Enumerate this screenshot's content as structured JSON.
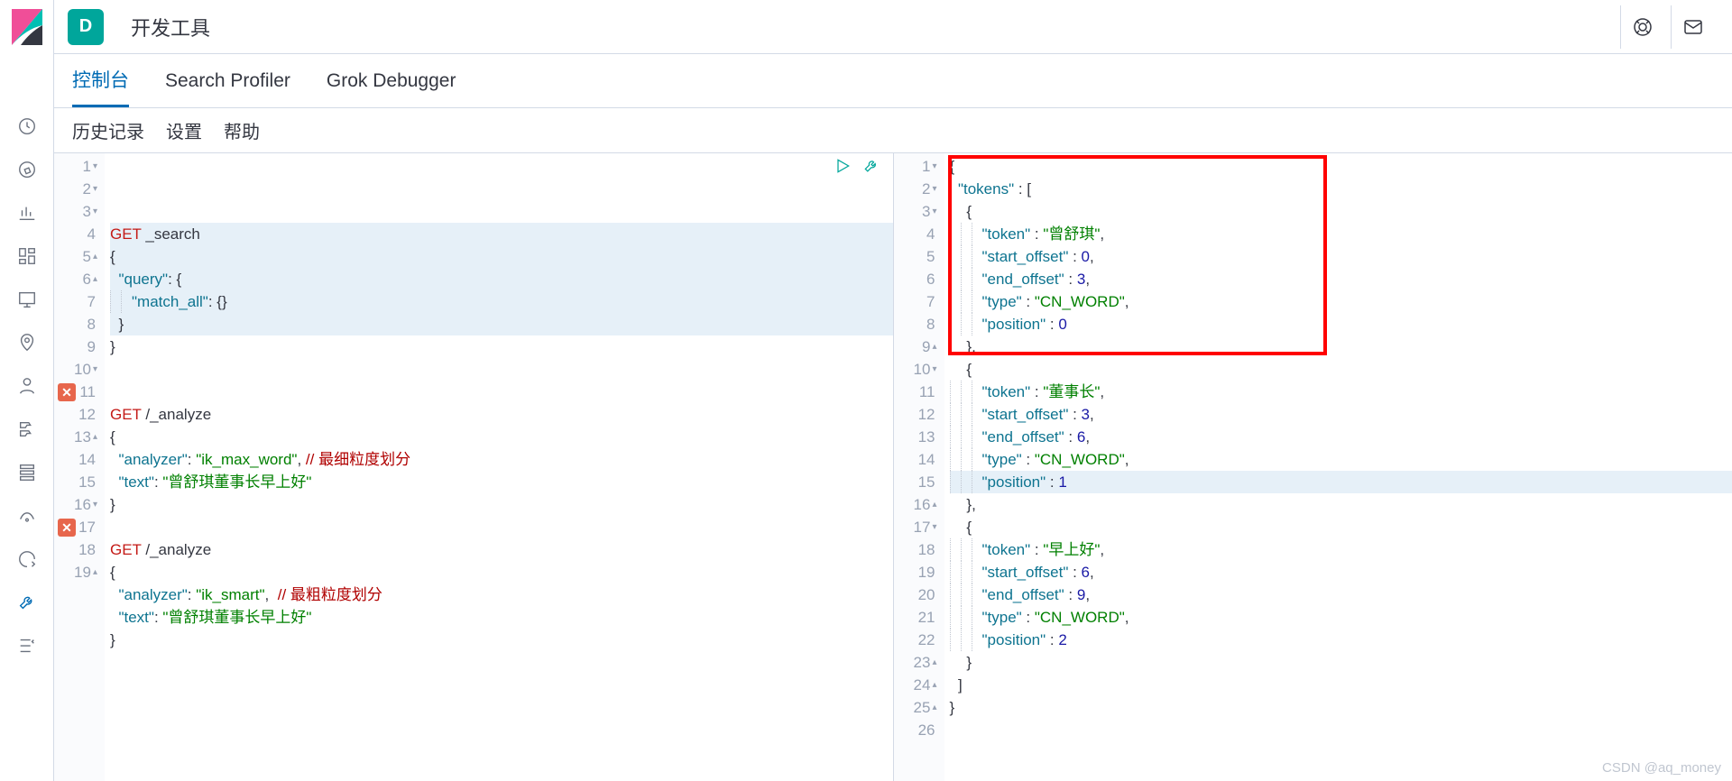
{
  "app_badge": "D",
  "title": "开发工具",
  "tabs": {
    "console": "控制台",
    "profiler": "Search Profiler",
    "grok": "Grok Debugger"
  },
  "menu": {
    "history": "历史记录",
    "settings": "设置",
    "help": "帮助"
  },
  "req_lines": [
    {
      "n": 1,
      "fold": "▾",
      "hl": true,
      "segments": [
        {
          "t": "GET ",
          "c": "kw"
        },
        {
          "t": "_search"
        }
      ]
    },
    {
      "n": 2,
      "fold": "▾",
      "hl": true,
      "segments": [
        {
          "t": "{"
        }
      ]
    },
    {
      "n": 3,
      "fold": "▾",
      "hl": true,
      "segments": [
        {
          "t": "  "
        },
        {
          "t": "\"query\"",
          "c": "key"
        },
        {
          "t": ": {"
        }
      ]
    },
    {
      "n": 4,
      "fold": "",
      "hl": true,
      "guides": 2,
      "segments": [
        {
          "t": "\"match_all\"",
          "c": "key"
        },
        {
          "t": ": {}"
        }
      ]
    },
    {
      "n": 5,
      "fold": "▴",
      "hl": true,
      "segments": [
        {
          "t": "  }"
        }
      ]
    },
    {
      "n": 6,
      "fold": "▴",
      "segments": [
        {
          "t": "}"
        }
      ]
    },
    {
      "n": 7,
      "segments": []
    },
    {
      "n": 8,
      "segments": []
    },
    {
      "n": 9,
      "segments": [
        {
          "t": "GET ",
          "c": "kw"
        },
        {
          "t": "/_analyze"
        }
      ]
    },
    {
      "n": 10,
      "fold": "▾",
      "segments": [
        {
          "t": "{"
        }
      ]
    },
    {
      "n": 11,
      "err": true,
      "segments": [
        {
          "t": "  "
        },
        {
          "t": "\"analyzer\"",
          "c": "key"
        },
        {
          "t": ": "
        },
        {
          "t": "\"ik_max_word\"",
          "c": "str"
        },
        {
          "t": ", "
        },
        {
          "t": "// 最细粒度划分",
          "c": "comment"
        }
      ]
    },
    {
      "n": 12,
      "segments": [
        {
          "t": "  "
        },
        {
          "t": "\"text\"",
          "c": "key"
        },
        {
          "t": ": "
        },
        {
          "t": "\"曾舒琪董事长早上好\"",
          "c": "str"
        }
      ]
    },
    {
      "n": 13,
      "fold": "▴",
      "segments": [
        {
          "t": "}"
        }
      ]
    },
    {
      "n": 14,
      "segments": []
    },
    {
      "n": 15,
      "segments": [
        {
          "t": "GET ",
          "c": "kw"
        },
        {
          "t": "/_analyze"
        }
      ]
    },
    {
      "n": 16,
      "fold": "▾",
      "segments": [
        {
          "t": "{"
        }
      ]
    },
    {
      "n": 17,
      "err": true,
      "segments": [
        {
          "t": "  "
        },
        {
          "t": "\"analyzer\"",
          "c": "key"
        },
        {
          "t": ": "
        },
        {
          "t": "\"ik_smart\"",
          "c": "str"
        },
        {
          "t": ",  "
        },
        {
          "t": "// 最粗粒度划分",
          "c": "comment"
        }
      ]
    },
    {
      "n": 18,
      "segments": [
        {
          "t": "  "
        },
        {
          "t": "\"text\"",
          "c": "key"
        },
        {
          "t": ": "
        },
        {
          "t": "\"曾舒琪董事长早上好\"",
          "c": "str"
        }
      ]
    },
    {
      "n": 19,
      "fold": "▴",
      "segments": [
        {
          "t": "}"
        }
      ]
    }
  ],
  "res_lines": [
    {
      "n": 1,
      "fold": "▾",
      "segments": [
        {
          "t": "{"
        }
      ]
    },
    {
      "n": 2,
      "fold": "▾",
      "segments": [
        {
          "t": "  "
        },
        {
          "t": "\"tokens\"",
          "c": "key"
        },
        {
          "t": " : ["
        }
      ]
    },
    {
      "n": 3,
      "fold": "▾",
      "segments": [
        {
          "t": "    {"
        }
      ]
    },
    {
      "n": 4,
      "guides": 3,
      "segments": [
        {
          "t": "\"token\"",
          "c": "key"
        },
        {
          "t": " : "
        },
        {
          "t": "\"曾舒琪\"",
          "c": "str"
        },
        {
          "t": ","
        }
      ]
    },
    {
      "n": 5,
      "guides": 3,
      "segments": [
        {
          "t": "\"start_offset\"",
          "c": "key"
        },
        {
          "t": " : "
        },
        {
          "t": "0",
          "c": "num"
        },
        {
          "t": ","
        }
      ]
    },
    {
      "n": 6,
      "guides": 3,
      "segments": [
        {
          "t": "\"end_offset\"",
          "c": "key"
        },
        {
          "t": " : "
        },
        {
          "t": "3",
          "c": "num"
        },
        {
          "t": ","
        }
      ]
    },
    {
      "n": 7,
      "guides": 3,
      "segments": [
        {
          "t": "\"type\"",
          "c": "key"
        },
        {
          "t": " : "
        },
        {
          "t": "\"CN_WORD\"",
          "c": "str"
        },
        {
          "t": ","
        }
      ]
    },
    {
      "n": 8,
      "guides": 3,
      "segments": [
        {
          "t": "\"position\"",
          "c": "key"
        },
        {
          "t": " : "
        },
        {
          "t": "0",
          "c": "num"
        }
      ]
    },
    {
      "n": 9,
      "fold": "▴",
      "segments": [
        {
          "t": "    },"
        }
      ]
    },
    {
      "n": 10,
      "fold": "▾",
      "segments": [
        {
          "t": "    {"
        }
      ]
    },
    {
      "n": 11,
      "guides": 3,
      "segments": [
        {
          "t": "\"token\"",
          "c": "key"
        },
        {
          "t": " : "
        },
        {
          "t": "\"董事长\"",
          "c": "str"
        },
        {
          "t": ","
        }
      ]
    },
    {
      "n": 12,
      "guides": 3,
      "segments": [
        {
          "t": "\"start_offset\"",
          "c": "key"
        },
        {
          "t": " : "
        },
        {
          "t": "3",
          "c": "num"
        },
        {
          "t": ","
        }
      ]
    },
    {
      "n": 13,
      "guides": 3,
      "segments": [
        {
          "t": "\"end_offset\"",
          "c": "key"
        },
        {
          "t": " : "
        },
        {
          "t": "6",
          "c": "num"
        },
        {
          "t": ","
        }
      ]
    },
    {
      "n": 14,
      "guides": 3,
      "segments": [
        {
          "t": "\"type\"",
          "c": "key"
        },
        {
          "t": " : "
        },
        {
          "t": "\"CN_WORD\"",
          "c": "str"
        },
        {
          "t": ","
        }
      ]
    },
    {
      "n": 15,
      "hl": true,
      "guides": 3,
      "segments": [
        {
          "t": "\"position\"",
          "c": "key"
        },
        {
          "t": " : "
        },
        {
          "t": "1",
          "c": "num"
        }
      ]
    },
    {
      "n": 16,
      "fold": "▴",
      "segments": [
        {
          "t": "    },"
        }
      ]
    },
    {
      "n": 17,
      "fold": "▾",
      "segments": [
        {
          "t": "    {"
        }
      ]
    },
    {
      "n": 18,
      "guides": 3,
      "segments": [
        {
          "t": "\"token\"",
          "c": "key"
        },
        {
          "t": " : "
        },
        {
          "t": "\"早上好\"",
          "c": "str"
        },
        {
          "t": ","
        }
      ]
    },
    {
      "n": 19,
      "guides": 3,
      "segments": [
        {
          "t": "\"start_offset\"",
          "c": "key"
        },
        {
          "t": " : "
        },
        {
          "t": "6",
          "c": "num"
        },
        {
          "t": ","
        }
      ]
    },
    {
      "n": 20,
      "guides": 3,
      "segments": [
        {
          "t": "\"end_offset\"",
          "c": "key"
        },
        {
          "t": " : "
        },
        {
          "t": "9",
          "c": "num"
        },
        {
          "t": ","
        }
      ]
    },
    {
      "n": 21,
      "guides": 3,
      "segments": [
        {
          "t": "\"type\"",
          "c": "key"
        },
        {
          "t": " : "
        },
        {
          "t": "\"CN_WORD\"",
          "c": "str"
        },
        {
          "t": ","
        }
      ]
    },
    {
      "n": 22,
      "guides": 3,
      "segments": [
        {
          "t": "\"position\"",
          "c": "key"
        },
        {
          "t": " : "
        },
        {
          "t": "2",
          "c": "num"
        }
      ]
    },
    {
      "n": 23,
      "fold": "▴",
      "segments": [
        {
          "t": "    }"
        }
      ]
    },
    {
      "n": 24,
      "fold": "▴",
      "segments": [
        {
          "t": "  ]"
        }
      ]
    },
    {
      "n": 25,
      "fold": "▴",
      "segments": [
        {
          "t": "}"
        }
      ]
    },
    {
      "n": 26,
      "segments": []
    }
  ],
  "watermark": "CSDN @aq_money"
}
